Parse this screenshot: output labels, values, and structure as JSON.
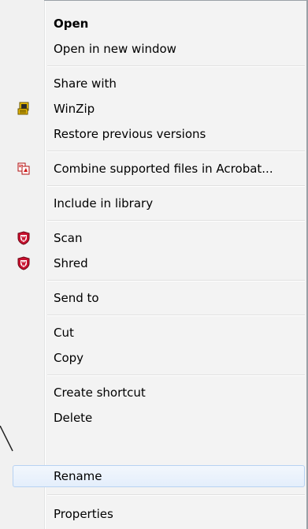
{
  "menu": {
    "items": [
      {
        "label": "Open",
        "icon": null
      },
      {
        "label": "Open in new window",
        "icon": null
      },
      {
        "label": "Share with",
        "icon": null
      },
      {
        "label": "WinZip",
        "icon": "winzip-icon"
      },
      {
        "label": "Restore previous versions",
        "icon": null
      },
      {
        "label": "Combine supported files in Acrobat...",
        "icon": "acrobat-icon"
      },
      {
        "label": "Include in library",
        "icon": null
      },
      {
        "label": "Scan",
        "icon": "mcafee-shield-icon"
      },
      {
        "label": "Shred",
        "icon": "mcafee-shield-icon"
      },
      {
        "label": "Send to",
        "icon": null
      },
      {
        "label": "Cut",
        "icon": null
      },
      {
        "label": "Copy",
        "icon": null
      },
      {
        "label": "Create shortcut",
        "icon": null
      },
      {
        "label": "Delete",
        "icon": null
      },
      {
        "label": "Rename",
        "icon": null
      },
      {
        "label": "Properties",
        "icon": null
      }
    ],
    "default_item": "Open",
    "highlighted_item": "Rename"
  },
  "colors": {
    "menu_bg": "#f3f3f3",
    "highlight_border": "#b7d2f2",
    "mcafee_red": "#c8102e",
    "winzip_yellow": "#f2c300"
  }
}
